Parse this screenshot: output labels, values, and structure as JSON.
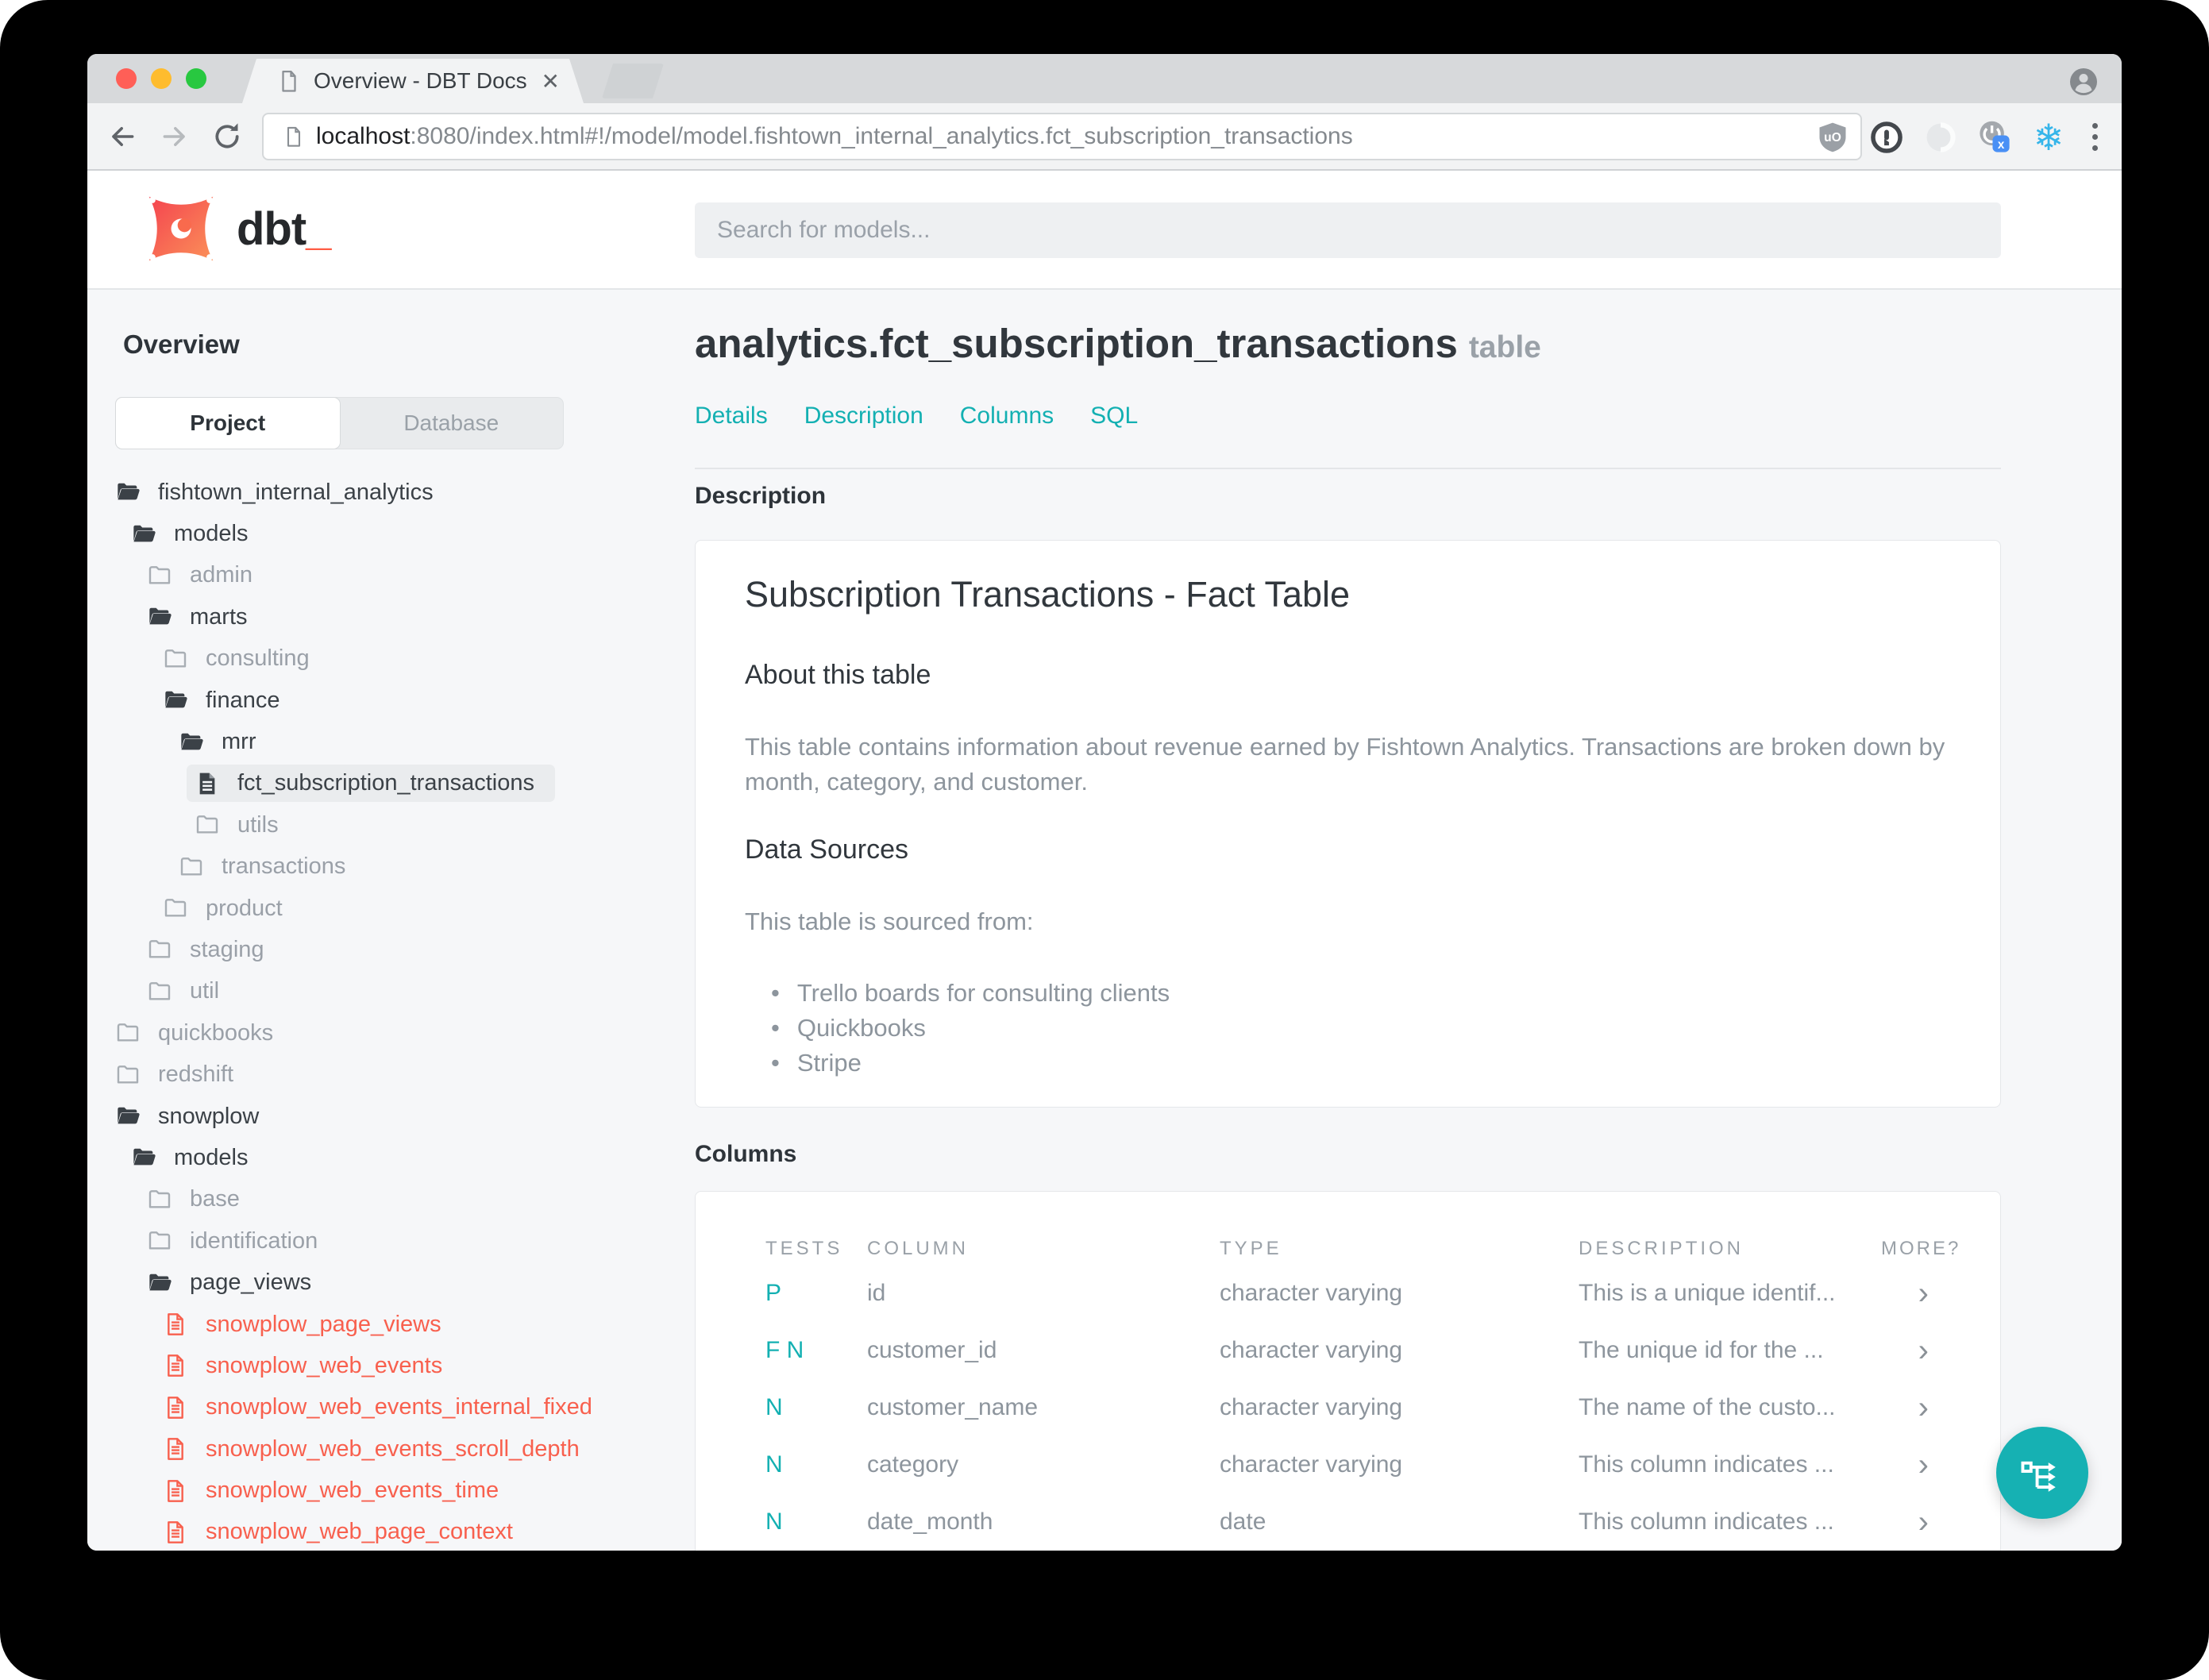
{
  "colors": {
    "accent_teal": "#13b0b2",
    "accent_red": "#f8604e",
    "logo_orange": "#ff5c44",
    "traffic_red": "#ff5f57",
    "traffic_yellow": "#febc2e",
    "traffic_green": "#28c840"
  },
  "browser": {
    "tab_title": "Overview - DBT Docs",
    "close_glyph": "✕",
    "url_host": "localhost",
    "url_rest": ":8080/index.html#!/model/model.fishtown_internal_analytics.fct_subscription_transactions",
    "extensions": [
      "ublock-origin-icon",
      "onepassword-icon",
      "loop-icon",
      "power-x-icon",
      "snowflake-icon"
    ],
    "snowflake_glyph": "❄"
  },
  "header": {
    "logo_text": "dbt",
    "logo_underscore": "_",
    "search_placeholder": "Search for models..."
  },
  "sidebar": {
    "title": "Overview",
    "tabs": [
      {
        "label": "Project",
        "active": true
      },
      {
        "label": "Database",
        "active": false
      }
    ],
    "tree": [
      {
        "label": "fishtown_internal_analytics",
        "level": 0,
        "icon": "folder-open-icon",
        "tone": "dark"
      },
      {
        "label": "models",
        "level": 1,
        "icon": "folder-open-icon",
        "tone": "dark"
      },
      {
        "label": "admin",
        "level": 2,
        "icon": "folder-icon",
        "tone": "gray"
      },
      {
        "label": "marts",
        "level": 2,
        "icon": "folder-open-icon",
        "tone": "dark"
      },
      {
        "label": "consulting",
        "level": 3,
        "icon": "folder-icon",
        "tone": "gray"
      },
      {
        "label": "finance",
        "level": 3,
        "icon": "folder-open-icon",
        "tone": "dark"
      },
      {
        "label": "mrr",
        "level": 4,
        "icon": "folder-open-icon",
        "tone": "dark"
      },
      {
        "label": "fct_subscription_transactions",
        "level": 5,
        "icon": "file-icon",
        "tone": "dark",
        "selected": true
      },
      {
        "label": "utils",
        "level": 5,
        "icon": "folder-icon",
        "tone": "gray"
      },
      {
        "label": "transactions",
        "level": 4,
        "icon": "folder-icon",
        "tone": "gray"
      },
      {
        "label": "product",
        "level": 3,
        "icon": "folder-icon",
        "tone": "gray"
      },
      {
        "label": "staging",
        "level": 2,
        "icon": "folder-icon",
        "tone": "gray"
      },
      {
        "label": "util",
        "level": 2,
        "icon": "folder-icon",
        "tone": "gray"
      },
      {
        "label": "quickbooks",
        "level": 0,
        "icon": "folder-icon",
        "tone": "gray"
      },
      {
        "label": "redshift",
        "level": 0,
        "icon": "folder-icon",
        "tone": "gray"
      },
      {
        "label": "snowplow",
        "level": 0,
        "icon": "folder-open-icon",
        "tone": "dark"
      },
      {
        "label": "models",
        "level": 1,
        "icon": "folder-open-icon",
        "tone": "dark"
      },
      {
        "label": "base",
        "level": 2,
        "icon": "folder-icon",
        "tone": "gray"
      },
      {
        "label": "identification",
        "level": 2,
        "icon": "folder-icon",
        "tone": "gray"
      },
      {
        "label": "page_views",
        "level": 2,
        "icon": "folder-open-icon",
        "tone": "dark"
      },
      {
        "label": "snowplow_page_views",
        "level": 3,
        "icon": "file-red-icon",
        "tone": "red"
      },
      {
        "label": "snowplow_web_events",
        "level": 3,
        "icon": "file-red-icon",
        "tone": "red"
      },
      {
        "label": "snowplow_web_events_internal_fixed",
        "level": 3,
        "icon": "file-red-icon",
        "tone": "red"
      },
      {
        "label": "snowplow_web_events_scroll_depth",
        "level": 3,
        "icon": "file-red-icon",
        "tone": "red"
      },
      {
        "label": "snowplow_web_events_time",
        "level": 3,
        "icon": "file-red-icon",
        "tone": "red"
      },
      {
        "label": "snowplow_web_page_context",
        "level": 3,
        "icon": "file-red-icon",
        "tone": "red"
      }
    ]
  },
  "main": {
    "title": "analytics.fct_subscription_transactions",
    "title_suffix": "table",
    "nav": [
      "Details",
      "Description",
      "Columns",
      "SQL"
    ],
    "description_section": {
      "heading": "Description",
      "card_title": "Subscription Transactions - Fact Table",
      "about_heading": "About this table",
      "about_text": "This table contains information about revenue earned by Fishtown Analytics. Transactions are broken down by month, category, and customer.",
      "sources_heading": "Data Sources",
      "sources_intro": "This table is sourced from:",
      "bullet_glyph": "•",
      "sources": [
        "Trello boards for consulting clients",
        "Quickbooks",
        "Stripe"
      ]
    },
    "columns_section": {
      "heading": "Columns",
      "table": {
        "headers": {
          "tests": "TESTS",
          "column": "COLUMN",
          "type": "TYPE",
          "description": "DESCRIPTION",
          "more": "MORE?"
        },
        "chevron_glyph": "›",
        "rows": [
          {
            "tests": "P",
            "column": "id",
            "type": "character varying",
            "description": "This is a unique identif..."
          },
          {
            "tests": "F N",
            "column": "customer_id",
            "type": "character varying",
            "description": "The unique id for the ..."
          },
          {
            "tests": "N",
            "column": "customer_name",
            "type": "character varying",
            "description": "The name of the custo..."
          },
          {
            "tests": "N",
            "column": "category",
            "type": "character varying",
            "description": "This column indicates ..."
          },
          {
            "tests": "N",
            "column": "date_month",
            "type": "date",
            "description": "This column indicates ..."
          }
        ]
      }
    }
  }
}
